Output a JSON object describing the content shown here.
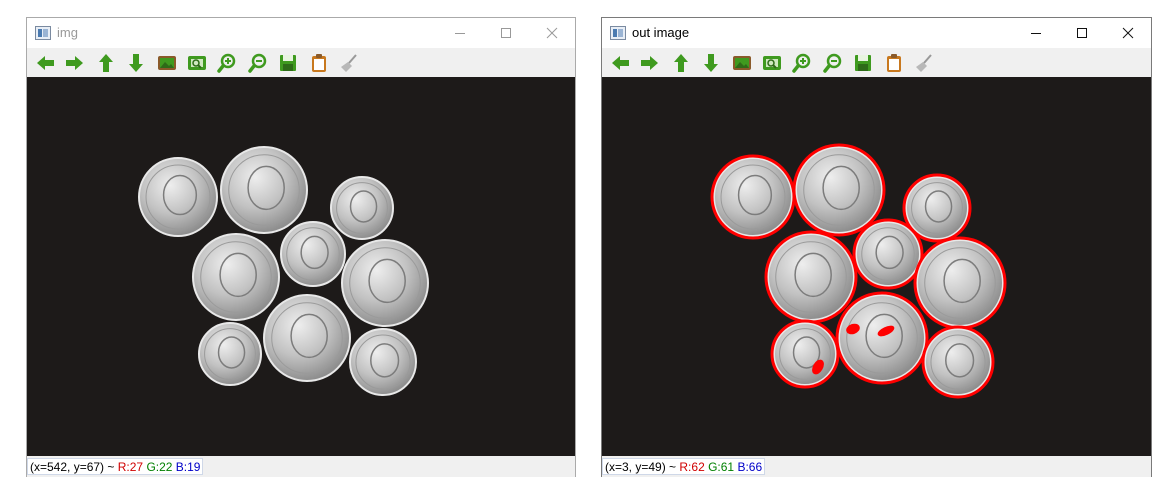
{
  "windows": [
    {
      "title": "img",
      "status": {
        "coords": "(x=542, y=67) ~",
        "r": "R:27",
        "g": "G:22",
        "b": "B:19"
      }
    },
    {
      "title": "out image",
      "status": {
        "coords": "(x=3, y=49) ~",
        "r": "R:62",
        "g": "G:61",
        "b": "B:66"
      }
    }
  ],
  "toolbar": {
    "buttons": [
      {
        "name": "pan-left-button",
        "icon": "arrow-left-icon"
      },
      {
        "name": "pan-right-button",
        "icon": "arrow-right-icon"
      },
      {
        "name": "pan-up-button",
        "icon": "arrow-up-icon"
      },
      {
        "name": "pan-down-button",
        "icon": "arrow-down-icon"
      },
      {
        "name": "zoom-original-button",
        "icon": "image-icon"
      },
      {
        "name": "zoom-fit-button",
        "icon": "zoom-fit-icon"
      },
      {
        "name": "zoom-in-button",
        "icon": "zoom-in-icon"
      },
      {
        "name": "zoom-out-button",
        "icon": "zoom-out-icon"
      },
      {
        "name": "save-button",
        "icon": "save-icon"
      },
      {
        "name": "properties-button",
        "icon": "clipboard-icon"
      },
      {
        "name": "clear-button",
        "icon": "broom-icon"
      }
    ]
  },
  "colors": {
    "canvas_bg": "#1d1a19",
    "contour": "#ff0000",
    "toolbar_icon": "#3f9a1f",
    "status_red": "#d00000",
    "status_green": "#008000",
    "status_blue": "#0000c8"
  }
}
